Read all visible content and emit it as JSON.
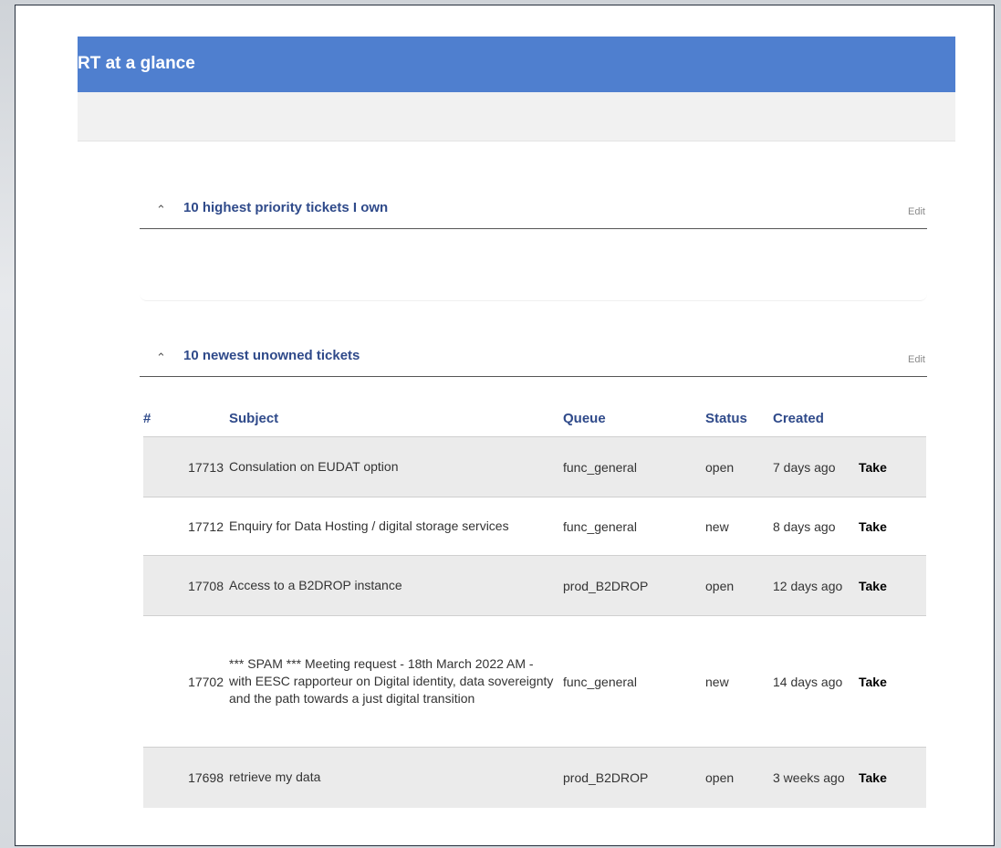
{
  "header": {
    "title": "RT at a glance"
  },
  "portlets": [
    {
      "title": "10 highest priority tickets I own",
      "edit_label": "Edit"
    },
    {
      "title": "10 newest unowned tickets",
      "edit_label": "Edit"
    }
  ],
  "table": {
    "columns": {
      "num": "#",
      "subject": "Subject",
      "queue": "Queue",
      "status": "Status",
      "created": "Created"
    },
    "rows": [
      {
        "id": "17713",
        "subject": "Consulation on EUDAT option",
        "queue": "func_general",
        "status": "open",
        "created": "7 days ago",
        "action": "Take"
      },
      {
        "id": "17712",
        "subject": "Enquiry for Data Hosting / digital storage services",
        "queue": "func_general",
        "status": "new",
        "created": "8 days ago",
        "action": "Take"
      },
      {
        "id": "17708",
        "subject": "Access to a B2DROP instance",
        "queue": "prod_B2DROP",
        "status": "open",
        "created": "12 days ago",
        "action": "Take"
      },
      {
        "id": "17702",
        "subject": "*** SPAM *** Meeting request - 18th March 2022 AM - with EESC rapporteur on Digital identity, data sovereignty and the path towards a just digital transition",
        "queue": "func_general",
        "status": "new",
        "created": "14 days ago",
        "action": "Take"
      },
      {
        "id": "17698",
        "subject": "retrieve my data",
        "queue": "prod_B2DROP",
        "status": "open",
        "created": "3 weeks ago",
        "action": "Take"
      }
    ]
  }
}
